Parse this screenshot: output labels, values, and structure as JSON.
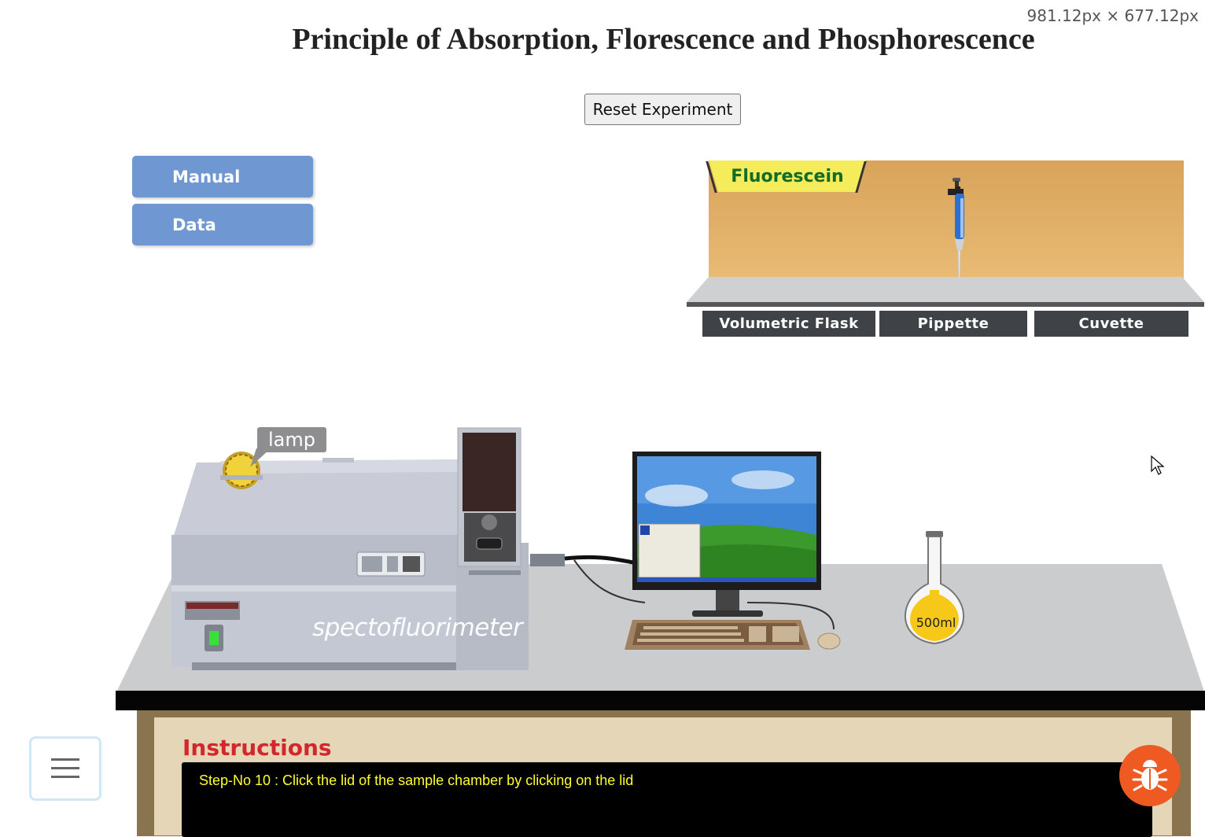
{
  "viewport_readout": "981.12px × 677.12px",
  "page_title": "Principle of Absorption, Florescence and Phosphorescence",
  "reset_button": "Reset Experiment",
  "sidebar": [
    {
      "label": "Manual"
    },
    {
      "label": "Data"
    }
  ],
  "shelf": {
    "reagent_label": "Fluorescein",
    "buttons": [
      {
        "label": "Volumetric Flask"
      },
      {
        "label": "Pippette"
      },
      {
        "label": "Cuvette"
      }
    ]
  },
  "bench": {
    "lamp_label": "lamp",
    "instrument_label": "spectofluorimeter",
    "flask_label": "500ml"
  },
  "instructions": {
    "title": "Instructions",
    "step_text": "Step-No 10 : Click the lid of the sample chamber by clicking on the lid"
  },
  "icons": {
    "menu": "hamburger-menu-icon",
    "bug": "bug-report-icon",
    "cursor": "mouse-cursor-icon"
  },
  "colors": {
    "side_button": "#6f98d3",
    "reagent_tag": "#f5ec5b",
    "instruction_title": "#d2272d",
    "instruction_text": "#ffff33",
    "bug_button": "#ef5a23"
  }
}
